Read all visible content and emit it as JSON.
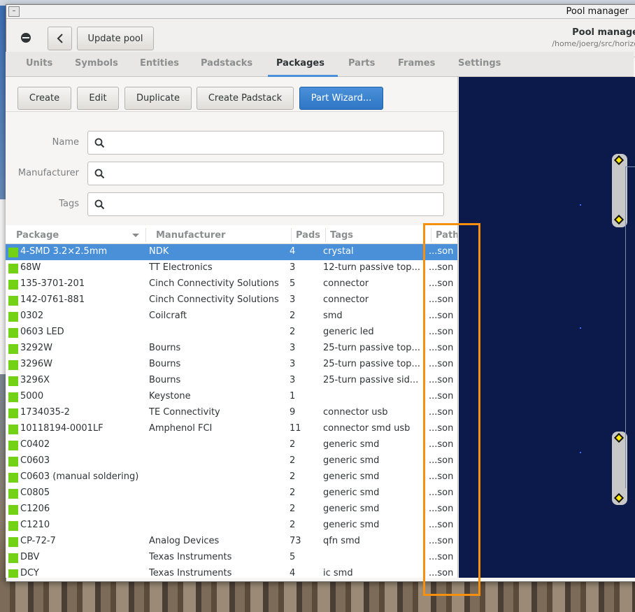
{
  "window": {
    "title": "Pool manager"
  },
  "header": {
    "update_label": "Update pool",
    "title": "Pool manage",
    "path": "/home/joerg/src/horizo"
  },
  "tabs": [
    {
      "label": "Units",
      "active": false
    },
    {
      "label": "Symbols",
      "active": false
    },
    {
      "label": "Entities",
      "active": false
    },
    {
      "label": "Padstacks",
      "active": false
    },
    {
      "label": "Packages",
      "active": true
    },
    {
      "label": "Parts",
      "active": false
    },
    {
      "label": "Frames",
      "active": false
    },
    {
      "label": "Settings",
      "active": false
    }
  ],
  "toolbar": {
    "create": "Create",
    "edit": "Edit",
    "duplicate": "Duplicate",
    "create_padstack": "Create Padstack",
    "part_wizard": "Part Wizard..."
  },
  "filters": {
    "name_label": "Name",
    "manufacturer_label": "Manufacturer",
    "tags_label": "Tags"
  },
  "table": {
    "headers": {
      "package": "Package",
      "manufacturer": "Manufacturer",
      "pads": "Pads",
      "tags": "Tags",
      "path": "Path"
    },
    "rows": [
      {
        "package": "4-SMD 3.2×2.5mm",
        "manufacturer": "NDK",
        "pads": "4",
        "tags": "crystal",
        "path": "...son",
        "selected": true
      },
      {
        "package": "68W",
        "manufacturer": "TT Electronics",
        "pads": "3",
        "tags": "12-turn passive top...",
        "path": "...son"
      },
      {
        "package": "135-3701-201",
        "manufacturer": "Cinch Connectivity Solutions",
        "pads": "5",
        "tags": "connector",
        "path": "...son"
      },
      {
        "package": "142-0761-881",
        "manufacturer": "Cinch Connectivity Solutions",
        "pads": "3",
        "tags": "connector",
        "path": "...son"
      },
      {
        "package": "0302",
        "manufacturer": "Coilcraft",
        "pads": "2",
        "tags": "smd",
        "path": "...son"
      },
      {
        "package": "0603 LED",
        "manufacturer": "",
        "pads": "2",
        "tags": "generic led",
        "path": "...son"
      },
      {
        "package": "3292W",
        "manufacturer": "Bourns",
        "pads": "3",
        "tags": "25-turn passive top...",
        "path": "...son"
      },
      {
        "package": "3296W",
        "manufacturer": "Bourns",
        "pads": "3",
        "tags": "25-turn passive top...",
        "path": "...son"
      },
      {
        "package": "3296X",
        "manufacturer": "Bourns",
        "pads": "3",
        "tags": "25-turn passive sid...",
        "path": "...son"
      },
      {
        "package": "5000",
        "manufacturer": "Keystone",
        "pads": "1",
        "tags": "",
        "path": "...son"
      },
      {
        "package": "1734035-2",
        "manufacturer": "TE Connectivity",
        "pads": "9",
        "tags": "connector usb",
        "path": "...son"
      },
      {
        "package": "10118194-0001LF",
        "manufacturer": "Amphenol FCI",
        "pads": "11",
        "tags": "connector smd usb",
        "path": "...son"
      },
      {
        "package": "C0402",
        "manufacturer": "",
        "pads": "2",
        "tags": "generic smd",
        "path": "...son"
      },
      {
        "package": "C0603",
        "manufacturer": "",
        "pads": "2",
        "tags": "generic smd",
        "path": "...son"
      },
      {
        "package": "C0603 (manual soldering)",
        "manufacturer": "",
        "pads": "2",
        "tags": "generic smd",
        "path": "...son"
      },
      {
        "package": "C0805",
        "manufacturer": "",
        "pads": "2",
        "tags": "generic smd",
        "path": "...son"
      },
      {
        "package": "C1206",
        "manufacturer": "",
        "pads": "2",
        "tags": "generic smd",
        "path": "...son"
      },
      {
        "package": "C1210",
        "manufacturer": "",
        "pads": "2",
        "tags": "generic smd",
        "path": "...son"
      },
      {
        "package": "CP-72-7",
        "manufacturer": "Analog Devices",
        "pads": "73",
        "tags": "qfn smd",
        "path": "...son"
      },
      {
        "package": "DBV",
        "manufacturer": "Texas Instruments",
        "pads": "5",
        "tags": "",
        "path": "...son"
      },
      {
        "package": "DCY",
        "manufacturer": "Texas Instruments",
        "pads": "4",
        "tags": "ic smd",
        "path": "...son"
      }
    ]
  },
  "colors": {
    "accent": "#4a90d9",
    "swatch": "#73d216",
    "preview_bg": "#0b1a4a",
    "highlight": "#f5900e"
  }
}
